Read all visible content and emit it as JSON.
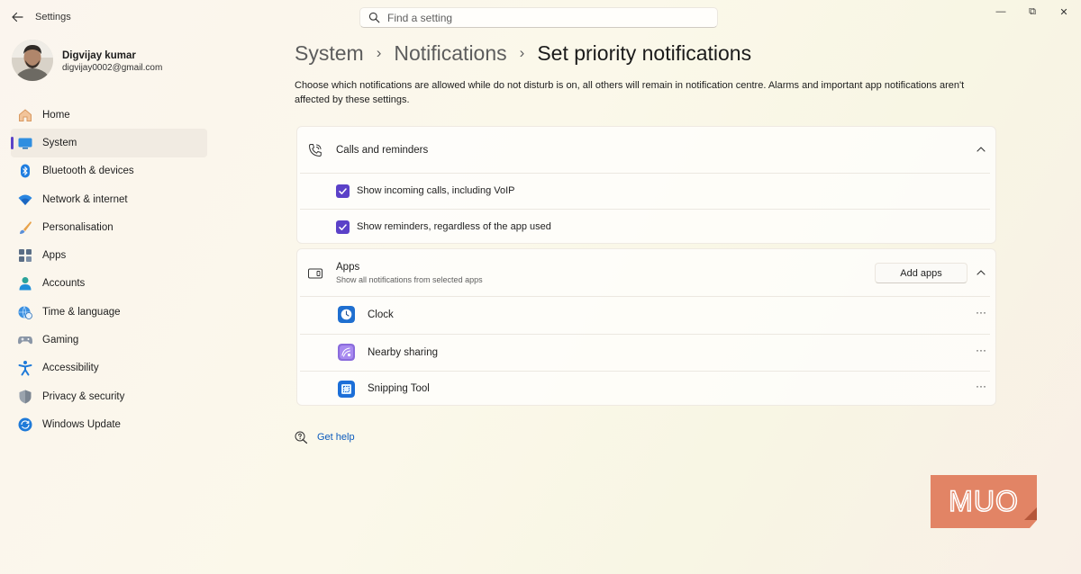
{
  "window": {
    "title": "Settings",
    "minimize": "—",
    "maximize": "⧉",
    "close": "✕"
  },
  "search": {
    "placeholder": "Find a setting",
    "value": ""
  },
  "profile": {
    "name": "Digvijay kumar",
    "email": "digvijay0002@gmail.com"
  },
  "sidebar": {
    "items": [
      {
        "label": "Home",
        "icon": "home-icon"
      },
      {
        "label": "System",
        "icon": "system-icon",
        "active": true
      },
      {
        "label": "Bluetooth & devices",
        "icon": "bluetooth-icon"
      },
      {
        "label": "Network & internet",
        "icon": "wifi-icon"
      },
      {
        "label": "Personalisation",
        "icon": "brush-icon"
      },
      {
        "label": "Apps",
        "icon": "apps-icon"
      },
      {
        "label": "Accounts",
        "icon": "account-icon"
      },
      {
        "label": "Time & language",
        "icon": "globe-clock-icon"
      },
      {
        "label": "Gaming",
        "icon": "gamepad-icon"
      },
      {
        "label": "Accessibility",
        "icon": "accessibility-icon"
      },
      {
        "label": "Privacy & security",
        "icon": "shield-icon"
      },
      {
        "label": "Windows Update",
        "icon": "update-icon"
      }
    ]
  },
  "breadcrumb": {
    "items": [
      "System",
      "Notifications",
      "Set priority notifications"
    ],
    "separator": "›"
  },
  "description": "Choose which notifications are allowed while do not disturb is on, all others will remain in notification centre. Alarms and important app notifications aren't affected by these settings.",
  "calls_card": {
    "title": "Calls and reminders",
    "options": [
      {
        "label": "Show incoming calls, including VoIP",
        "checked": true
      },
      {
        "label": "Show reminders, regardless of the app used",
        "checked": true
      }
    ]
  },
  "apps_card": {
    "title": "Apps",
    "subtitle": "Show all notifications from selected apps",
    "add_button": "Add apps",
    "apps": [
      {
        "name": "Clock",
        "icon": "clock-app-icon"
      },
      {
        "name": "Nearby sharing",
        "icon": "nearby-sharing-icon"
      },
      {
        "name": "Snipping Tool",
        "icon": "snipping-tool-icon"
      }
    ],
    "more_label": "···"
  },
  "help": {
    "label": "Get help"
  },
  "watermark": {
    "text": "MUO"
  },
  "colors": {
    "accent": "#5b41c8",
    "link": "#0b5bbd",
    "watermark": "#e07b5a"
  }
}
